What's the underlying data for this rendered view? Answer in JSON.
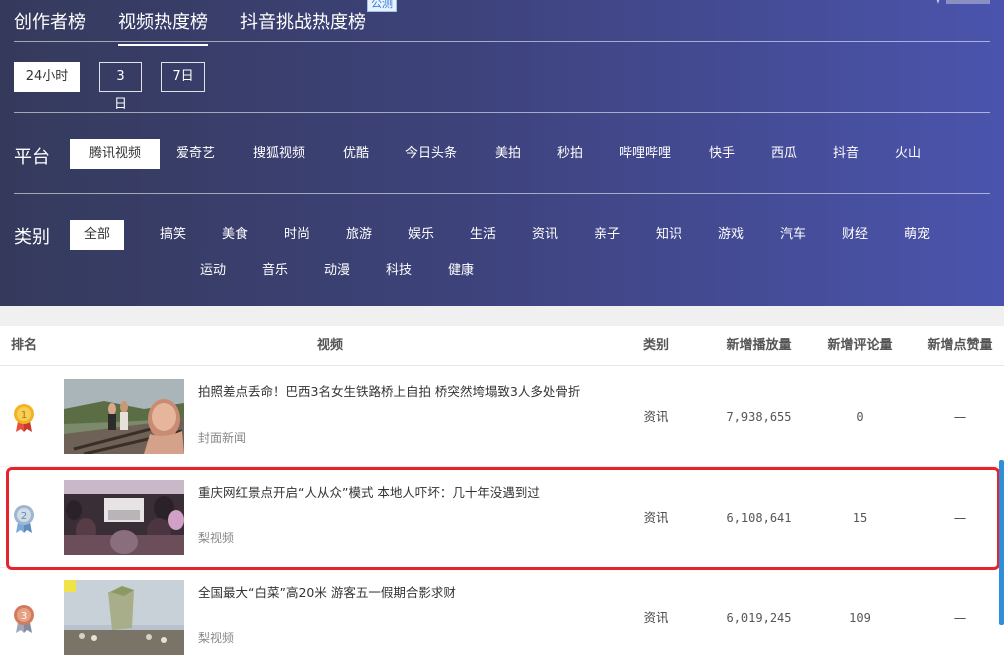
{
  "tabs": [
    {
      "label": "创作者榜",
      "active": false
    },
    {
      "label": "视频热度榜",
      "active": true
    },
    {
      "label": "抖音挑战热度榜",
      "active": false
    }
  ],
  "beta_badge": "公测",
  "time_filters": [
    {
      "label": "24小时",
      "active": true
    },
    {
      "label": "3日",
      "active": false
    },
    {
      "label": "7日",
      "active": false
    }
  ],
  "platform": {
    "label": "平台",
    "items": [
      "腾讯视频",
      "爱奇艺",
      "搜狐视频",
      "优酷",
      "今日头条",
      "美拍",
      "秒拍",
      "哔哩哔哩",
      "快手",
      "西瓜",
      "抖音",
      "火山"
    ],
    "active_index": 0
  },
  "category": {
    "label": "类别",
    "active_label": "全部",
    "items": [
      "搞笑",
      "美食",
      "时尚",
      "旅游",
      "娱乐",
      "生活",
      "资讯",
      "亲子",
      "知识",
      "游戏",
      "汽车",
      "财经",
      "萌宠",
      "运动",
      "音乐",
      "动漫",
      "科技",
      "健康"
    ]
  },
  "table": {
    "headers": {
      "rank": "排名",
      "video": "视频",
      "category": "类别",
      "plays": "新增播放量",
      "comments": "新增评论量",
      "likes": "新增点赞量"
    },
    "rows": [
      {
        "rank": "1",
        "title": "拍照差点丢命！巴西3名女生铁路桥上自拍 桥突然垮塌致3人多处骨折",
        "source": "封面新闻",
        "category": "资讯",
        "plays": "7,938,655",
        "comments": "0",
        "likes": "—"
      },
      {
        "rank": "2",
        "title": "重庆网红景点开启“人从众”模式 本地人吓坏：几十年没遇到过",
        "source": "梨视频",
        "category": "资讯",
        "plays": "6,108,641",
        "comments": "15",
        "likes": "—"
      },
      {
        "rank": "3",
        "title": "全国最大“白菜”高20米 游客五一假期合影求财",
        "source": "梨视频",
        "category": "资讯",
        "plays": "6,019,245",
        "comments": "109",
        "likes": "—"
      }
    ]
  },
  "colors": {
    "header_start": "#353a5c",
    "header_end": "#4b54ad",
    "highlight": "#e8232a",
    "gold": "#f0b323",
    "silver": "#9fb6cf",
    "bronze": "#d07a5e"
  }
}
